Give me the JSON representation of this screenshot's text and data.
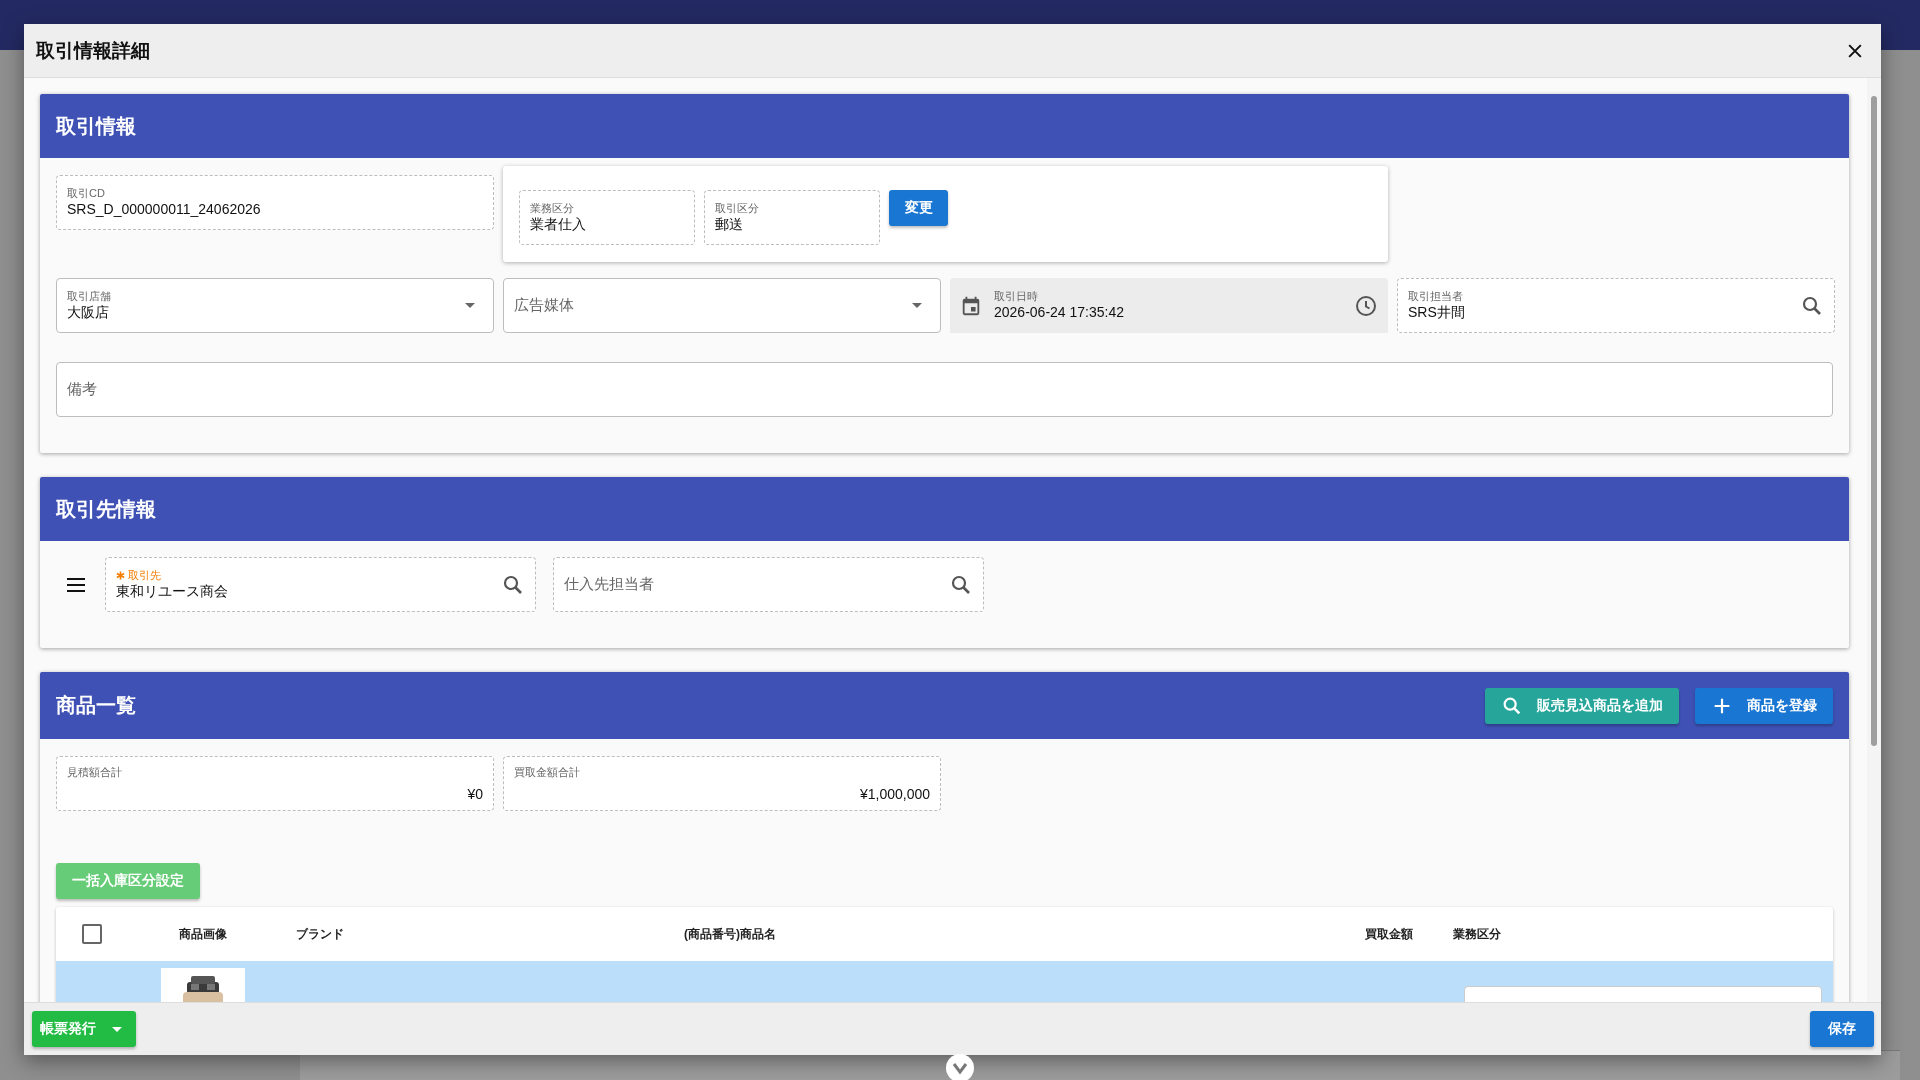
{
  "dialog": {
    "title": "取引情報詳細"
  },
  "transaction": {
    "title": "取引情報",
    "code": {
      "label": "取引CD",
      "value": "SRS_D_000000011_24062026"
    },
    "business_type": {
      "label": "業務区分",
      "value": "業者仕入"
    },
    "transaction_type": {
      "label": "取引区分",
      "value": "郵送"
    },
    "change_button": "変更",
    "store": {
      "label": "取引店舗",
      "value": "大阪店"
    },
    "ad_media": {
      "placeholder": "広告媒体"
    },
    "datetime": {
      "label": "取引日時",
      "value": "2026-06-24 17:35:42"
    },
    "staff": {
      "label": "取引担当者",
      "value": "SRS井間"
    },
    "note": {
      "placeholder": "備考"
    }
  },
  "partner": {
    "title": "取引先情報",
    "partner": {
      "label": "取引先",
      "required": true,
      "value": "東和リユース商会"
    },
    "contact": {
      "placeholder": "仕入先担当者"
    }
  },
  "products": {
    "title": "商品一覧",
    "buttons": [
      {
        "kind": "search",
        "label": "販売見込商品を追加"
      },
      {
        "kind": "add",
        "label": "商品を登録"
      }
    ],
    "totals": [
      {
        "label": "見積額合計",
        "value": "¥0"
      },
      {
        "label": "買取金額合計",
        "value": "¥1,000,000"
      }
    ],
    "bulk_button": "一括入庫区分設定",
    "table": {
      "select_all_checked": false,
      "columns": [
        "商品画像",
        "ブランド",
        "(商品番号)商品名",
        "買取金額",
        "業務区分"
      ],
      "rows": [
        {
          "selected": true
        }
      ]
    }
  },
  "footer": {
    "print_button": "帳票発行",
    "save_button": "保存"
  }
}
